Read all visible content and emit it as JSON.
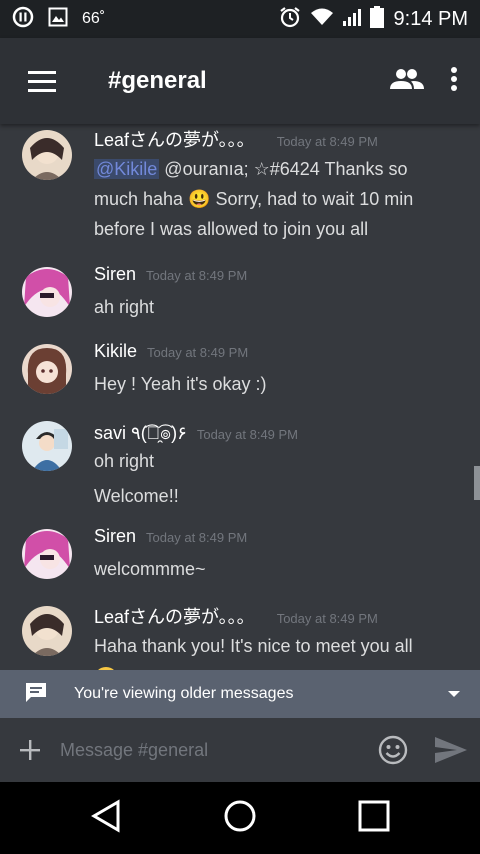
{
  "status_bar": {
    "temperature": "66˚",
    "time": "9:14 PM"
  },
  "header": {
    "menu_icon": "hamburger-menu-icon",
    "channel_name": "#general",
    "members_icon": "people-icon",
    "overflow_icon": "more-vert-icon"
  },
  "messages": [
    {
      "author": "Leafさんの夢が。。。",
      "timestamp": "Today at 8:49 PM",
      "lines": [
        {
          "mention": "@Kikile",
          "text": " @ouranıa; ☆#6424 Thanks so"
        },
        {
          "text": "much haha 😃 Sorry, had to wait 10 min"
        },
        {
          "text": "before I was allowed to join you all"
        }
      ]
    },
    {
      "author": "Siren",
      "timestamp": "Today at 8:49 PM",
      "lines": [
        {
          "text": "ah right"
        }
      ]
    },
    {
      "author": "Kikile",
      "timestamp": "Today at 8:49 PM",
      "lines": [
        {
          "text": "Hey ! Yeah it's okay :)"
        }
      ]
    },
    {
      "author": "savi ٩(͡๏̯͡๏)۶",
      "timestamp": "Today at 8:49 PM",
      "lines": [
        {
          "text": "oh right"
        },
        {
          "text": "Welcome!!"
        }
      ]
    },
    {
      "author": "Siren",
      "timestamp": "Today at 8:49 PM",
      "lines": [
        {
          "text": "welcommme~"
        }
      ]
    },
    {
      "author": "Leafさんの夢が。。。",
      "timestamp": "Today at 8:49 PM",
      "lines": [
        {
          "text": "Haha thank you! It's nice to meet you all"
        }
      ]
    }
  ],
  "older_banner": {
    "text": "You're viewing older messages"
  },
  "composer": {
    "placeholder": "Message #general"
  },
  "colors": {
    "background": "#36393e",
    "header": "#2e3136",
    "mention": "#7289da",
    "banner": "#5a6270"
  }
}
